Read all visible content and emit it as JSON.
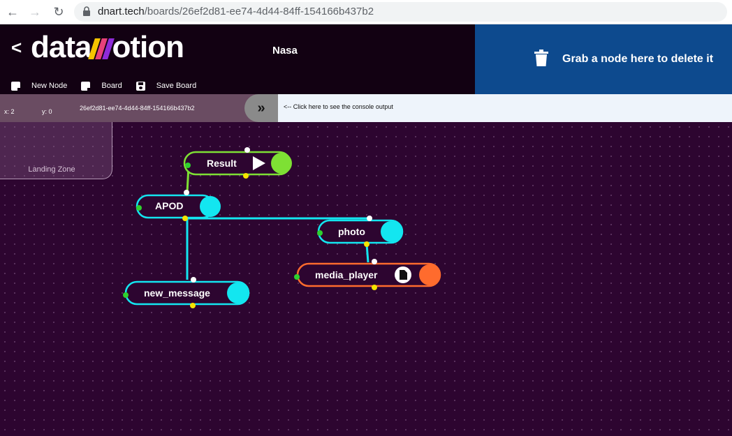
{
  "browser": {
    "url_host": "dnart.tech",
    "url_path": "/boards/26ef2d81-ee74-4d44-84ff-154166b437b2"
  },
  "header": {
    "back_label": "<",
    "logo_prefix": "data",
    "logo_suffix": "otion",
    "board_title": "Nasa",
    "toolbar": {
      "new_node": "New Node",
      "board": "Board",
      "save_board": "Save Board"
    }
  },
  "trash": {
    "label": "Grab a node here to delete it"
  },
  "status": {
    "x": "x: 2",
    "y": "y: 0",
    "board_id": "26ef2d81-ee74-4d44-84ff-154166b437b2",
    "console_hint": "<-- Click here to see the console output"
  },
  "landing_zone": {
    "label": "Landing Zone"
  },
  "nodes": {
    "result": "Result",
    "apod": "APOD",
    "photo": "photo",
    "media_player": "media_player",
    "new_message": "new_message"
  },
  "colors": {
    "green": "#7ee034",
    "cyan": "#13e6f0",
    "orange": "#ff6b2d",
    "trash_blue": "#0d4a8e"
  }
}
